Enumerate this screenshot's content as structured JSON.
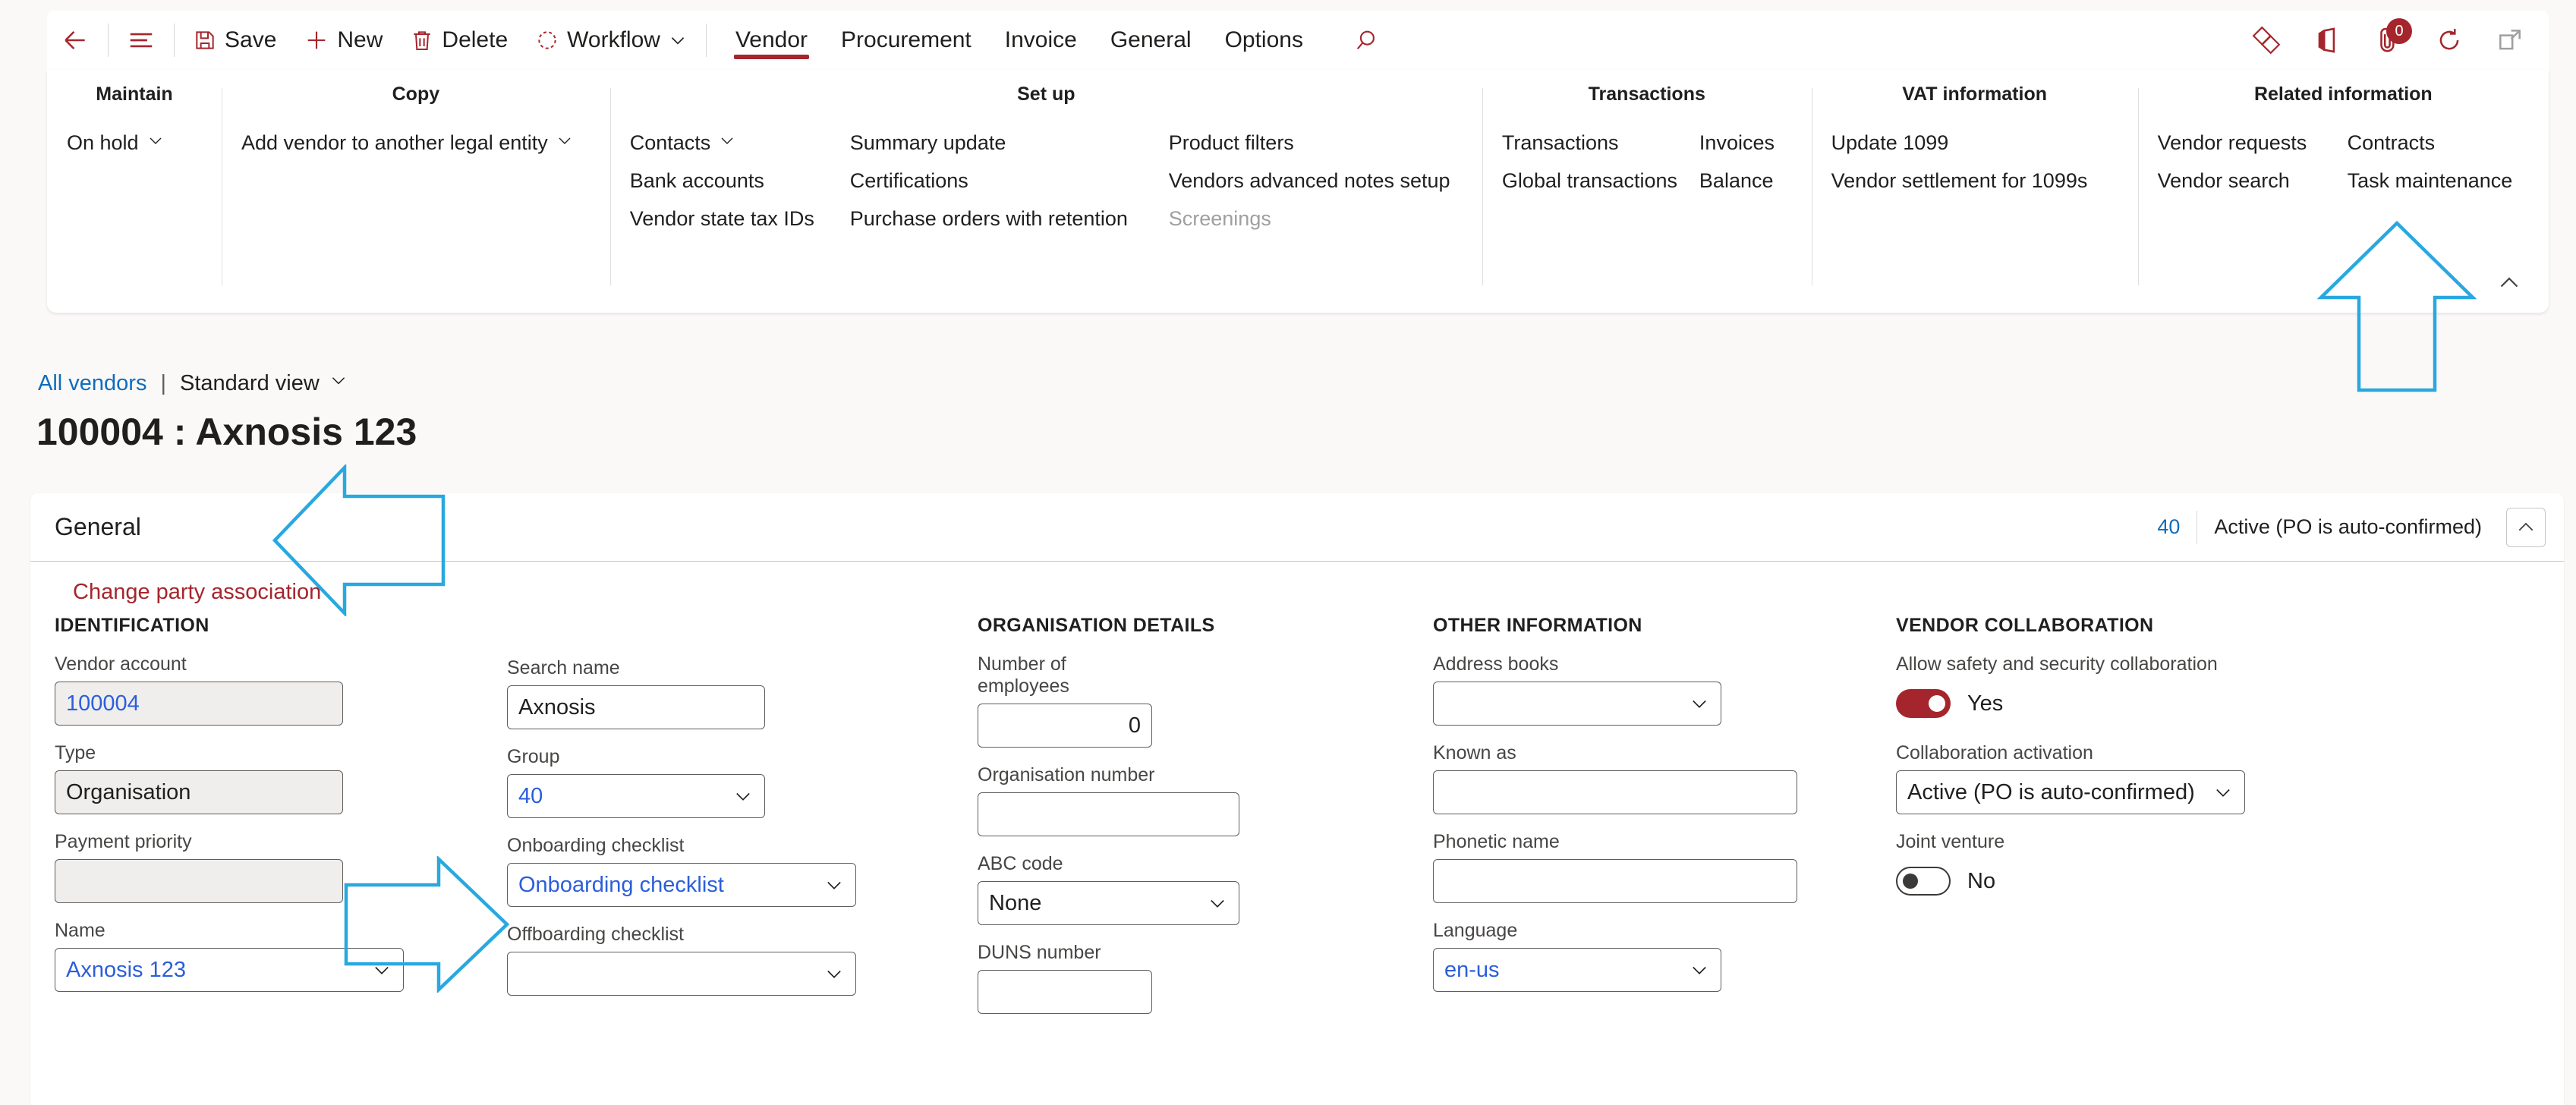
{
  "commandbar": {
    "back_label": "Back",
    "menu_label": "Show navigation",
    "save_label": "Save",
    "new_label": "New",
    "delete_label": "Delete",
    "workflow_label": "Workflow",
    "search_label": "Search",
    "notification_count": "0",
    "tabs": [
      {
        "label": "Vendor",
        "active": true
      },
      {
        "label": "Procurement",
        "active": false
      },
      {
        "label": "Invoice",
        "active": false
      },
      {
        "label": "General",
        "active": false
      },
      {
        "label": "Options",
        "active": false
      }
    ],
    "right_icons": [
      "diamond-app-icon",
      "office-apps-icon",
      "attachments-icon",
      "refresh-icon",
      "open-in-new-window-icon"
    ]
  },
  "ribbon": {
    "groups": [
      {
        "title": "Maintain",
        "columns": [
          {
            "items": [
              {
                "label": "On hold",
                "dropdown": true,
                "disabled": false
              }
            ]
          }
        ]
      },
      {
        "title": "Copy",
        "columns": [
          {
            "items": [
              {
                "label": "Add vendor to another legal entity",
                "dropdown": true,
                "disabled": false
              }
            ]
          }
        ]
      },
      {
        "title": "Set up",
        "columns": [
          {
            "items": [
              {
                "label": "Contacts",
                "dropdown": true,
                "disabled": false
              },
              {
                "label": "Bank accounts",
                "dropdown": false,
                "disabled": false
              },
              {
                "label": "Vendor state tax IDs",
                "dropdown": false,
                "disabled": false
              }
            ]
          },
          {
            "items": [
              {
                "label": "Summary update",
                "dropdown": false,
                "disabled": false
              },
              {
                "label": "Certifications",
                "dropdown": false,
                "disabled": false
              },
              {
                "label": "Purchase orders with retention",
                "dropdown": false,
                "disabled": false
              }
            ]
          },
          {
            "items": [
              {
                "label": "Product filters",
                "dropdown": false,
                "disabled": false
              },
              {
                "label": "Vendors advanced notes setup",
                "dropdown": false,
                "disabled": false
              },
              {
                "label": "Screenings",
                "dropdown": false,
                "disabled": true
              }
            ]
          }
        ]
      },
      {
        "title": "Transactions",
        "columns": [
          {
            "items": [
              {
                "label": "Transactions",
                "dropdown": false,
                "disabled": false
              },
              {
                "label": "Global transactions",
                "dropdown": false,
                "disabled": false
              }
            ]
          },
          {
            "items": [
              {
                "label": "Invoices",
                "dropdown": false,
                "disabled": false
              },
              {
                "label": "Balance",
                "dropdown": false,
                "disabled": false
              }
            ]
          }
        ]
      },
      {
        "title": "VAT information",
        "columns": [
          {
            "items": [
              {
                "label": "Update 1099",
                "dropdown": false,
                "disabled": false
              },
              {
                "label": "Vendor settlement for 1099s",
                "dropdown": false,
                "disabled": false
              }
            ]
          }
        ]
      },
      {
        "title": "Related information",
        "columns": [
          {
            "items": [
              {
                "label": "Vendor requests",
                "dropdown": false,
                "disabled": false
              },
              {
                "label": "Vendor search",
                "dropdown": false,
                "disabled": false
              }
            ]
          },
          {
            "items": [
              {
                "label": "Contracts",
                "dropdown": false,
                "disabled": false
              },
              {
                "label": "Task maintenance",
                "dropdown": false,
                "disabled": false
              }
            ]
          }
        ]
      }
    ],
    "collapse_label": "Collapse the action pane"
  },
  "breadcrumb": {
    "parent": "All vendors",
    "separator": "|",
    "view": "Standard view"
  },
  "page_title": "100004 : Axnosis 123",
  "general_section": {
    "title": "General",
    "group_number": "40",
    "status": "Active (PO is auto-confirmed)",
    "change_party_link": "Change party association"
  },
  "form": {
    "identification": {
      "heading": "IDENTIFICATION",
      "fields": [
        {
          "label": "Vendor account",
          "value": "100004",
          "kind": "readonly-link"
        },
        {
          "label": "Type",
          "value": "Organisation",
          "kind": "readonly"
        },
        {
          "label": "Payment priority",
          "value": "",
          "kind": "readonly"
        },
        {
          "label": "Name",
          "value": "Axnosis 123",
          "kind": "combo-link"
        }
      ]
    },
    "names": {
      "heading": "",
      "fields": [
        {
          "label": "Search name",
          "value": "Axnosis",
          "kind": "text"
        },
        {
          "label": "Group",
          "value": "40",
          "kind": "combo-link"
        },
        {
          "label": "Onboarding checklist",
          "value": "Onboarding checklist",
          "kind": "combo-link"
        },
        {
          "label": "Offboarding checklist",
          "value": "",
          "kind": "combo"
        }
      ]
    },
    "organisation_details": {
      "heading": "ORGANISATION DETAILS",
      "fields": [
        {
          "label": "Number of employees",
          "value": "0",
          "kind": "number"
        },
        {
          "label": "Organisation number",
          "value": "",
          "kind": "text"
        },
        {
          "label": "ABC code",
          "value": "None",
          "kind": "combo"
        },
        {
          "label": "DUNS number",
          "value": "",
          "kind": "text"
        }
      ]
    },
    "other_information": {
      "heading": "OTHER INFORMATION",
      "fields": [
        {
          "label": "Address books",
          "value": "",
          "kind": "combo"
        },
        {
          "label": "Known as",
          "value": "",
          "kind": "text"
        },
        {
          "label": "Phonetic name",
          "value": "",
          "kind": "text"
        },
        {
          "label": "Language",
          "value": "en-us",
          "kind": "combo-link"
        }
      ]
    },
    "vendor_collaboration": {
      "heading": "VENDOR COLLABORATION",
      "safety_label": "Allow safety and security collaboration",
      "safety_state": "Yes",
      "activation_label": "Collaboration activation",
      "activation_value": "Active (PO is auto-confirmed)",
      "joint_venture_label": "Joint venture",
      "joint_venture_state": "No"
    }
  },
  "annotations": [
    {
      "name": "arrow-up-task-maintenance",
      "points_to": "Task maintenance"
    },
    {
      "name": "arrow-left-general-section",
      "points_to": "General"
    },
    {
      "name": "arrow-right-onboarding-checklist",
      "points_to": "Onboarding checklist"
    }
  ],
  "colors": {
    "accent": "#a4262c",
    "link": "#0f6cbd",
    "field_link": "#2b5eda",
    "annotation": "#29a8e0",
    "page_bg": "#faf9f8"
  }
}
